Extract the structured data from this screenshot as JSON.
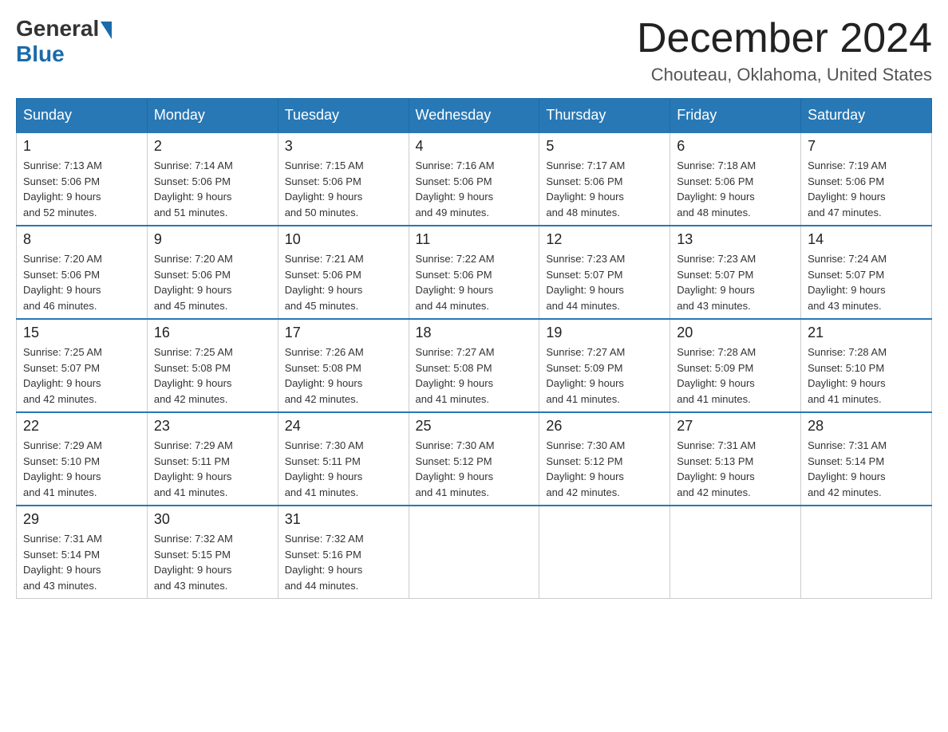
{
  "logo": {
    "general": "General",
    "blue": "Blue"
  },
  "title": "December 2024",
  "subtitle": "Chouteau, Oklahoma, United States",
  "days_of_week": [
    "Sunday",
    "Monday",
    "Tuesday",
    "Wednesday",
    "Thursday",
    "Friday",
    "Saturday"
  ],
  "weeks": [
    [
      {
        "day": "1",
        "sunrise": "7:13 AM",
        "sunset": "5:06 PM",
        "daylight": "9 hours and 52 minutes."
      },
      {
        "day": "2",
        "sunrise": "7:14 AM",
        "sunset": "5:06 PM",
        "daylight": "9 hours and 51 minutes."
      },
      {
        "day": "3",
        "sunrise": "7:15 AM",
        "sunset": "5:06 PM",
        "daylight": "9 hours and 50 minutes."
      },
      {
        "day": "4",
        "sunrise": "7:16 AM",
        "sunset": "5:06 PM",
        "daylight": "9 hours and 49 minutes."
      },
      {
        "day": "5",
        "sunrise": "7:17 AM",
        "sunset": "5:06 PM",
        "daylight": "9 hours and 48 minutes."
      },
      {
        "day": "6",
        "sunrise": "7:18 AM",
        "sunset": "5:06 PM",
        "daylight": "9 hours and 48 minutes."
      },
      {
        "day": "7",
        "sunrise": "7:19 AM",
        "sunset": "5:06 PM",
        "daylight": "9 hours and 47 minutes."
      }
    ],
    [
      {
        "day": "8",
        "sunrise": "7:20 AM",
        "sunset": "5:06 PM",
        "daylight": "9 hours and 46 minutes."
      },
      {
        "day": "9",
        "sunrise": "7:20 AM",
        "sunset": "5:06 PM",
        "daylight": "9 hours and 45 minutes."
      },
      {
        "day": "10",
        "sunrise": "7:21 AM",
        "sunset": "5:06 PM",
        "daylight": "9 hours and 45 minutes."
      },
      {
        "day": "11",
        "sunrise": "7:22 AM",
        "sunset": "5:06 PM",
        "daylight": "9 hours and 44 minutes."
      },
      {
        "day": "12",
        "sunrise": "7:23 AM",
        "sunset": "5:07 PM",
        "daylight": "9 hours and 44 minutes."
      },
      {
        "day": "13",
        "sunrise": "7:23 AM",
        "sunset": "5:07 PM",
        "daylight": "9 hours and 43 minutes."
      },
      {
        "day": "14",
        "sunrise": "7:24 AM",
        "sunset": "5:07 PM",
        "daylight": "9 hours and 43 minutes."
      }
    ],
    [
      {
        "day": "15",
        "sunrise": "7:25 AM",
        "sunset": "5:07 PM",
        "daylight": "9 hours and 42 minutes."
      },
      {
        "day": "16",
        "sunrise": "7:25 AM",
        "sunset": "5:08 PM",
        "daylight": "9 hours and 42 minutes."
      },
      {
        "day": "17",
        "sunrise": "7:26 AM",
        "sunset": "5:08 PM",
        "daylight": "9 hours and 42 minutes."
      },
      {
        "day": "18",
        "sunrise": "7:27 AM",
        "sunset": "5:08 PM",
        "daylight": "9 hours and 41 minutes."
      },
      {
        "day": "19",
        "sunrise": "7:27 AM",
        "sunset": "5:09 PM",
        "daylight": "9 hours and 41 minutes."
      },
      {
        "day": "20",
        "sunrise": "7:28 AM",
        "sunset": "5:09 PM",
        "daylight": "9 hours and 41 minutes."
      },
      {
        "day": "21",
        "sunrise": "7:28 AM",
        "sunset": "5:10 PM",
        "daylight": "9 hours and 41 minutes."
      }
    ],
    [
      {
        "day": "22",
        "sunrise": "7:29 AM",
        "sunset": "5:10 PM",
        "daylight": "9 hours and 41 minutes."
      },
      {
        "day": "23",
        "sunrise": "7:29 AM",
        "sunset": "5:11 PM",
        "daylight": "9 hours and 41 minutes."
      },
      {
        "day": "24",
        "sunrise": "7:30 AM",
        "sunset": "5:11 PM",
        "daylight": "9 hours and 41 minutes."
      },
      {
        "day": "25",
        "sunrise": "7:30 AM",
        "sunset": "5:12 PM",
        "daylight": "9 hours and 41 minutes."
      },
      {
        "day": "26",
        "sunrise": "7:30 AM",
        "sunset": "5:12 PM",
        "daylight": "9 hours and 42 minutes."
      },
      {
        "day": "27",
        "sunrise": "7:31 AM",
        "sunset": "5:13 PM",
        "daylight": "9 hours and 42 minutes."
      },
      {
        "day": "28",
        "sunrise": "7:31 AM",
        "sunset": "5:14 PM",
        "daylight": "9 hours and 42 minutes."
      }
    ],
    [
      {
        "day": "29",
        "sunrise": "7:31 AM",
        "sunset": "5:14 PM",
        "daylight": "9 hours and 43 minutes."
      },
      {
        "day": "30",
        "sunrise": "7:32 AM",
        "sunset": "5:15 PM",
        "daylight": "9 hours and 43 minutes."
      },
      {
        "day": "31",
        "sunrise": "7:32 AM",
        "sunset": "5:16 PM",
        "daylight": "9 hours and 44 minutes."
      },
      null,
      null,
      null,
      null
    ]
  ]
}
